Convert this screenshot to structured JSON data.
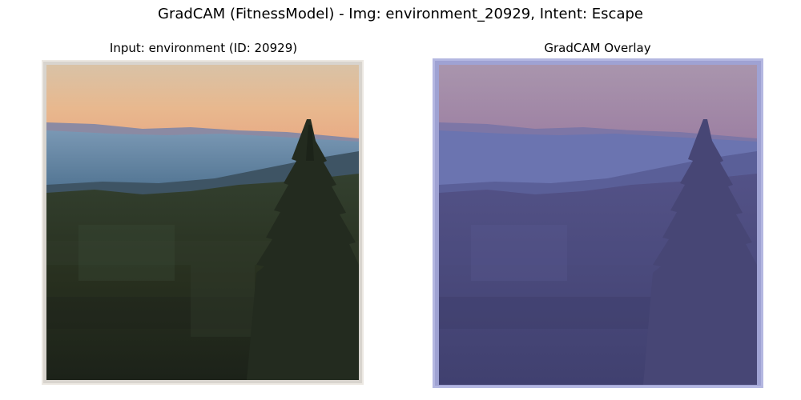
{
  "figure": {
    "suptitle": "GradCAM (FitnessModel) - Img: environment_20929, Intent: Escape"
  },
  "panels": [
    {
      "title": "Input: environment (ID: 20929)",
      "content": "landscape photograph: sunset sky over misty hills and a conifer forest",
      "colors": {
        "sky_top": "#d9bfa0",
        "sky_bottom": "#eab488",
        "mist": "#6a8ea8",
        "forest": "#2a3424",
        "frame": "#e8e4de"
      }
    },
    {
      "title": "GradCAM Overlay",
      "content": "same photograph with a uniform blue-purple GradCAM heatmap overlay",
      "colors": {
        "overlay": "#5a63b8",
        "frame": "#b3b6e0"
      }
    }
  ]
}
